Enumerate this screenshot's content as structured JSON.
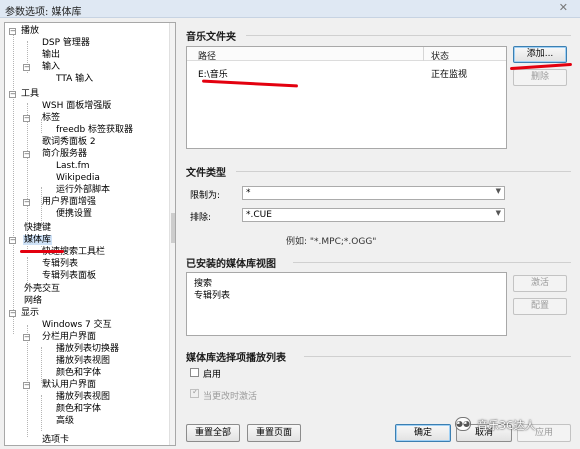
{
  "window": {
    "title": "参数选项: 媒体库",
    "close_glyph": "✕"
  },
  "tree": {
    "items": [
      {
        "label": "播放",
        "expander": "−"
      },
      {
        "label": "DSP 管理器"
      },
      {
        "label": "输出"
      },
      {
        "label": "输入",
        "expander": "−"
      },
      {
        "label": "TTA 输入"
      },
      {
        "label": "工具",
        "expander": "−"
      },
      {
        "label": "WSH 面板增强版"
      },
      {
        "label": "标签",
        "expander": "−"
      },
      {
        "label": "freedb 标签获取器"
      },
      {
        "label": "歌词秀面板 2"
      },
      {
        "label": "简介服务器",
        "expander": "−"
      },
      {
        "label": "Last.fm"
      },
      {
        "label": "Wikipedia"
      },
      {
        "label": "运行外部脚本"
      },
      {
        "label": "用户界面增强",
        "expander": "−"
      },
      {
        "label": "便携设置"
      },
      {
        "label": "快捷键"
      },
      {
        "label": "媒体库",
        "expander": "−"
      },
      {
        "label": "快速搜索工具栏"
      },
      {
        "label": "专辑列表"
      },
      {
        "label": "专辑列表面板"
      },
      {
        "label": "外壳交互"
      },
      {
        "label": "网络"
      },
      {
        "label": "显示",
        "expander": "−"
      },
      {
        "label": "Windows 7 交互"
      },
      {
        "label": "分栏用户界面",
        "expander": "−"
      },
      {
        "label": "播放列表切换器"
      },
      {
        "label": "播放列表视图"
      },
      {
        "label": "颜色和字体"
      },
      {
        "label": "默认用户界面",
        "expander": "−"
      },
      {
        "label": "播放列表视图"
      },
      {
        "label": "颜色和字体"
      },
      {
        "label": "高级"
      },
      {
        "label": "选项卡"
      }
    ]
  },
  "music_folders": {
    "section_title": "音乐文件夹",
    "columns": [
      "路径",
      "状态"
    ],
    "rows": [
      {
        "path": "E:\\音乐",
        "status": "正在监视"
      }
    ],
    "add_button": "添加...",
    "remove_button": "删除"
  },
  "file_types": {
    "section_title": "文件类型",
    "restrict_label": "限制为:",
    "restrict_value": "*",
    "exclude_label": "排除:",
    "exclude_value": "*.CUE",
    "example": "例如: \"*.MPC;*.OGG\""
  },
  "installed_views": {
    "section_title": "已安装的媒体库视图",
    "items": [
      "搜索",
      "专辑列表"
    ],
    "activate_button": "激活",
    "configure_button": "配置"
  },
  "playlist_select": {
    "section_title": "媒体库选择项播放列表",
    "enable_label": "启用",
    "activate_on_change_label": "当更改时激活"
  },
  "bottom_buttons": {
    "reset_all": "重置全部",
    "reset_page": "重置页面",
    "ok": "确定",
    "cancel": "取消",
    "apply": "应用"
  },
  "watermark": {
    "text": "音乐3C达人"
  },
  "colors": {
    "annotation_red": "#e3000f",
    "selection": "#cfe2f7"
  }
}
